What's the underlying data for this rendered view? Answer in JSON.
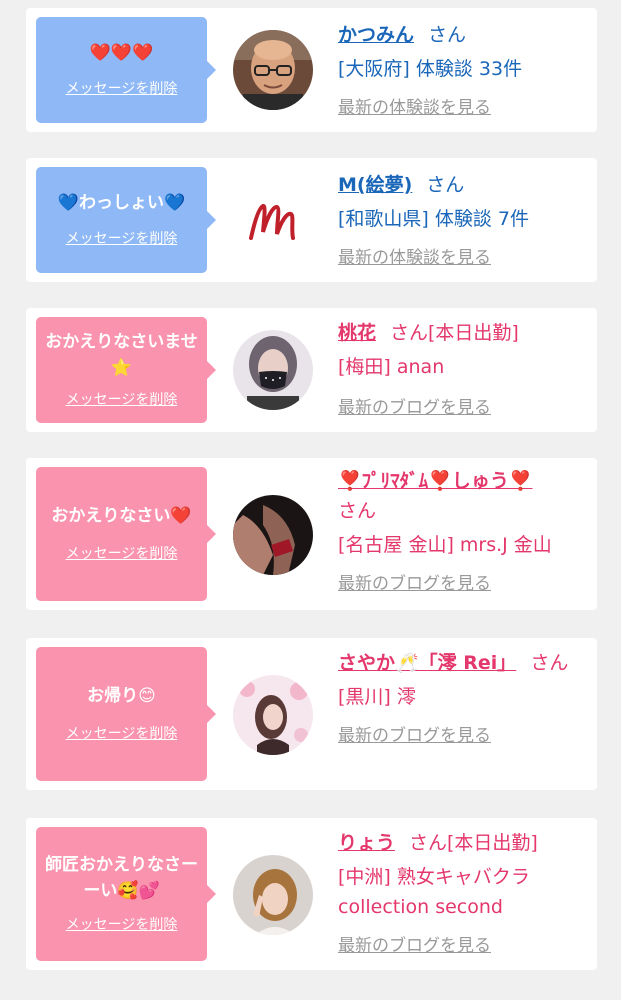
{
  "common": {
    "san": "さん",
    "delete_label": "メッセージを削除"
  },
  "colors": {
    "blue_bubble": "#8fb8f7",
    "pink_bubble": "#fa93ad",
    "blue_text": "#1a66b8",
    "pink_text": "#e4376c",
    "link_gray": "#999999"
  },
  "cards": [
    {
      "message": "❤️❤️❤️",
      "name": "かつみん",
      "san": "さん",
      "detail": "[大阪府] 体験談 33件",
      "latest_link": "最新の体験談を見る",
      "avatar": "bald-man-glasses-photo"
    },
    {
      "message": "💙わっしょい💙",
      "name": "M(絵夢)",
      "san": "さん",
      "detail": "[和歌山県] 体験談 7件",
      "latest_link": "最新の体験談を見る",
      "avatar": "red-letter-m-logo"
    },
    {
      "message": "おかえりなさいませ⭐",
      "name": "桃花",
      "san": "さん[本日出勤]",
      "detail": "[梅田] anan",
      "latest_link": "最新のブログを見る",
      "avatar": "woman-black-mask-photo"
    },
    {
      "message": "おかえりなさい❤️",
      "name": "❣️ﾌﾟﾘﾏﾀﾞﾑ❣️しゅう❣️",
      "san": "さん",
      "detail": "[名古屋 金山] mrs.J 金山",
      "latest_link": "最新のブログを見る",
      "avatar": "dark-legs-photo"
    },
    {
      "message": "お帰り😊",
      "name": "さやか🥂「澪 Rei」",
      "san": "さん",
      "detail": "[黒川] 澪",
      "latest_link": "最新のブログを見る",
      "avatar": "woman-pink-flowers-photo"
    },
    {
      "message": "師匠おかえりなさーーい🥰💕",
      "name": "りょう",
      "san": "さん[本日出勤]",
      "detail": "[中洲] 熟女キャバクラ collection second",
      "latest_link": "最新のブログを見る",
      "avatar": "woman-peace-sign-photo"
    }
  ]
}
